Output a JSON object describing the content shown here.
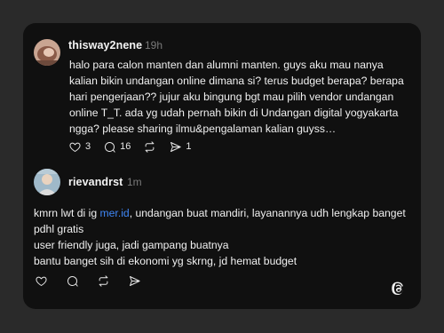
{
  "posts": [
    {
      "username": "thisway2nene",
      "time": "19h",
      "body": "halo para calon manten dan alumni manten. guys aku mau nanya kalian bikin undangan online dimana si? terus budget berapa? berapa hari pengerjaan?? jujur aku bingung bgt mau pilih vendor undangan online T_T. ada yg udah pernah bikin di Undangan digital yogyakarta ngga? please sharing ilmu&pengalaman kalian guyss…",
      "likes": "3",
      "replies": "16",
      "shares": "1"
    },
    {
      "username": "rievandrst",
      "time": "1m",
      "body_before_link": "kmrn lwt di ig ",
      "link": "mer.id",
      "body_after_link": ", undangan buat mandiri, layanannya udh lengkap banget pdhl gratis\nuser friendly juga, jadi gampang buatnya\nbantu banget sih di ekonomi yg skrng, jd hemat budget"
    }
  ],
  "icons": {
    "like": "heart-icon",
    "reply": "comment-icon",
    "repost": "repost-icon",
    "share": "send-icon",
    "brand": "threads-logo-icon"
  }
}
